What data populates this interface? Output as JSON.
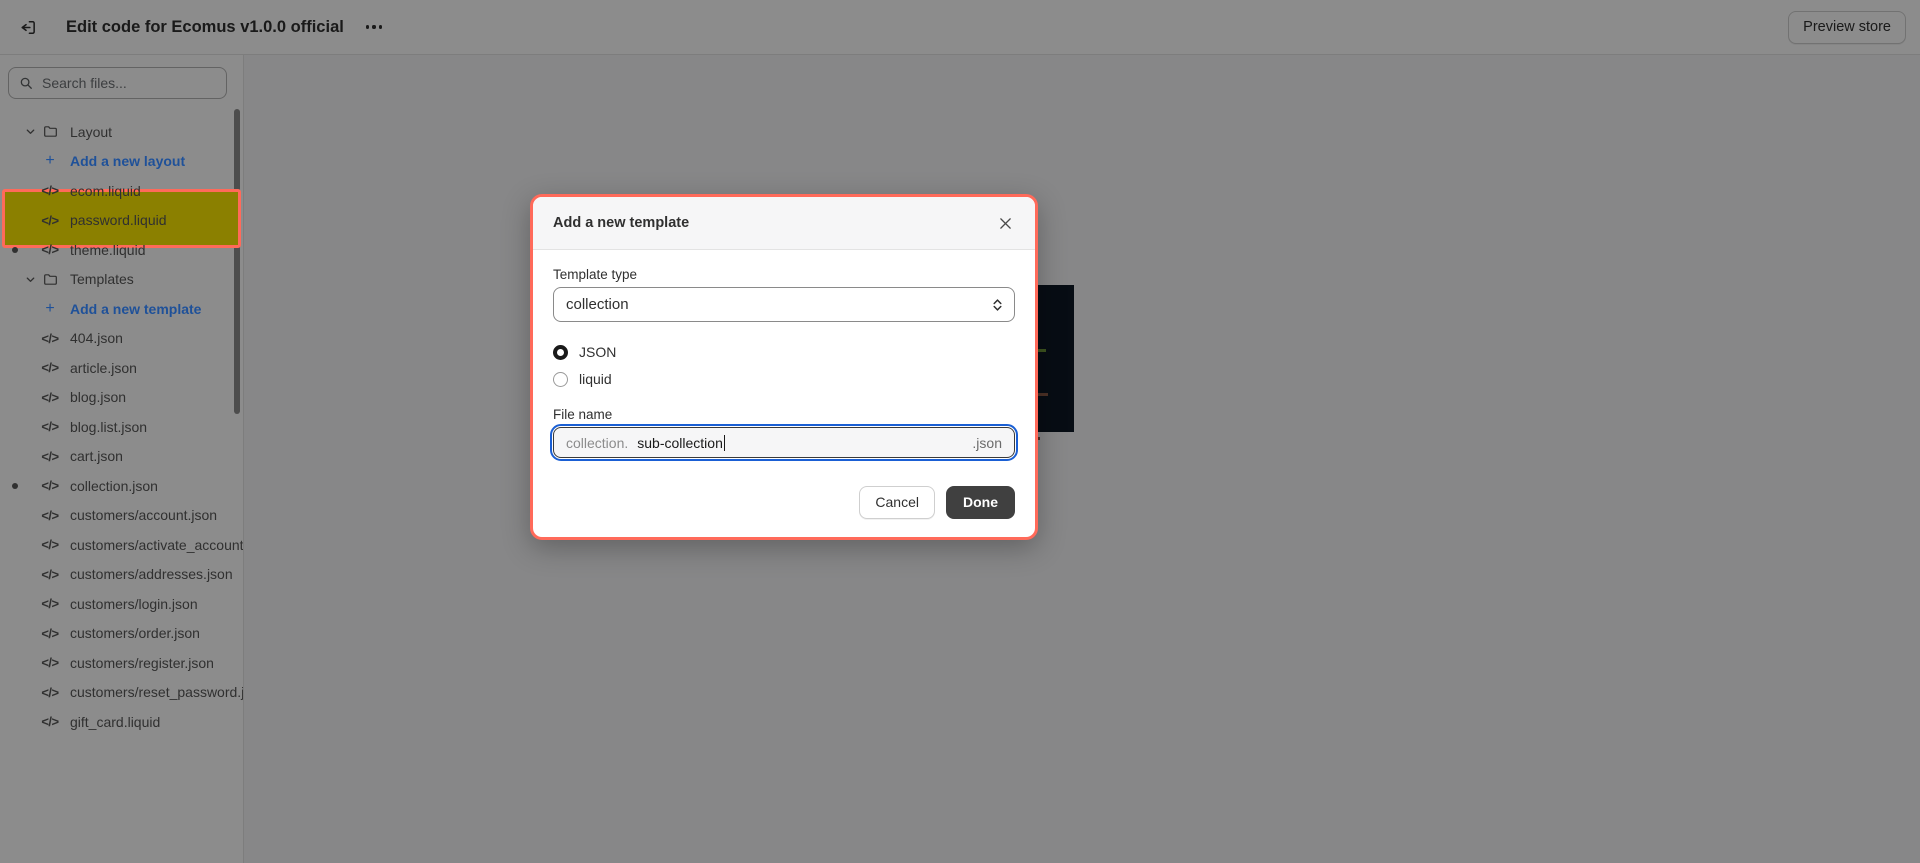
{
  "topbar": {
    "exit_icon": "exit-icon",
    "title": "Edit code for Ecomus v1.0.0 official",
    "more_icon": "more-horizontal-icon",
    "preview_label": "Preview store"
  },
  "sidebar": {
    "search": {
      "placeholder": "Search files...",
      "value": "",
      "icon": "search-icon"
    },
    "tree": [
      {
        "kind": "folder",
        "label": "Layout",
        "icon": "folder-icon",
        "caret": "chevron-down-icon",
        "modified": false
      },
      {
        "kind": "addnew",
        "label": "Add a new layout",
        "icon": "plus-icon",
        "modified": false
      },
      {
        "kind": "file",
        "label": "ecom.liquid",
        "icon": "code-icon",
        "modified": false
      },
      {
        "kind": "file",
        "label": "password.liquid",
        "icon": "code-icon",
        "modified": false
      },
      {
        "kind": "file",
        "label": "theme.liquid",
        "icon": "code-icon",
        "modified": true
      },
      {
        "kind": "folder",
        "label": "Templates",
        "icon": "folder-icon",
        "caret": "chevron-down-icon",
        "modified": false,
        "highlighted": true
      },
      {
        "kind": "addnew",
        "label": "Add a new template",
        "icon": "plus-icon",
        "modified": false,
        "highlighted": true
      },
      {
        "kind": "file",
        "label": "404.json",
        "icon": "code-icon",
        "modified": false
      },
      {
        "kind": "file",
        "label": "article.json",
        "icon": "code-icon",
        "modified": false
      },
      {
        "kind": "file",
        "label": "blog.json",
        "icon": "code-icon",
        "modified": false
      },
      {
        "kind": "file",
        "label": "blog.list.json",
        "icon": "code-icon",
        "modified": false
      },
      {
        "kind": "file",
        "label": "cart.json",
        "icon": "code-icon",
        "modified": false
      },
      {
        "kind": "file",
        "label": "collection.json",
        "icon": "code-icon",
        "modified": true
      },
      {
        "kind": "file",
        "label": "customers/account.json",
        "icon": "code-icon",
        "modified": false
      },
      {
        "kind": "file",
        "label": "customers/activate_account.json",
        "icon": "code-icon",
        "modified": false
      },
      {
        "kind": "file",
        "label": "customers/addresses.json",
        "icon": "code-icon",
        "modified": false
      },
      {
        "kind": "file",
        "label": "customers/login.json",
        "icon": "code-icon",
        "modified": false
      },
      {
        "kind": "file",
        "label": "customers/order.json",
        "icon": "code-icon",
        "modified": false
      },
      {
        "kind": "file",
        "label": "customers/register.json",
        "icon": "code-icon",
        "modified": false
      },
      {
        "kind": "file",
        "label": "customers/reset_password.json",
        "icon": "code-icon",
        "modified": false
      },
      {
        "kind": "file",
        "label": "gift_card.liquid",
        "icon": "code-icon",
        "modified": false
      }
    ]
  },
  "modal": {
    "title": "Add a new template",
    "close_icon": "close-icon",
    "template_type": {
      "label": "Template type",
      "value": "collection",
      "chevron_icon": "chevron-up-down-icon",
      "options": [
        "collection"
      ]
    },
    "format": {
      "selected": "JSON",
      "options": [
        {
          "label": "JSON",
          "checked": true
        },
        {
          "label": "liquid",
          "checked": false
        }
      ]
    },
    "file_name": {
      "label": "File name",
      "prefix": "collection.",
      "value": "sub-collection",
      "suffix": ".json",
      "placeholder": ""
    },
    "cancel_label": "Cancel",
    "done_label": "Done"
  },
  "colors": {
    "highlight_fill": "#8b8000",
    "highlight_border": "#ff6a5a",
    "modal_border": "#ff6a5a",
    "focus_ring": "#1a5fd4",
    "link": "#1f5199",
    "done_bg": "#404040",
    "editor_bg": "#0d1826",
    "scrim": "rgba(0,0,0,0.45)"
  }
}
